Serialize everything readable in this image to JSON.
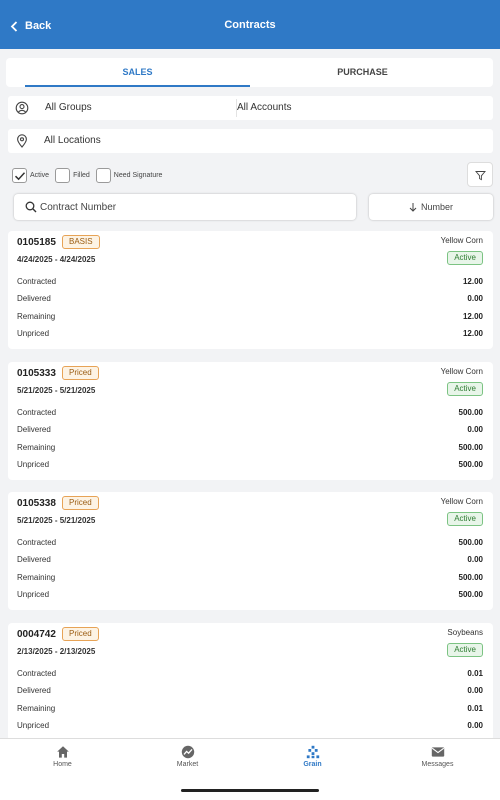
{
  "header": {
    "back_label": "Back",
    "title": "Contracts"
  },
  "tabs": [
    {
      "label": "SALES",
      "active": true
    },
    {
      "label": "PURCHASE",
      "active": false
    }
  ],
  "filters": {
    "groups": "All Groups",
    "accounts": "All Accounts",
    "locations": "All Locations",
    "checkboxes": [
      {
        "label": "Active",
        "checked": true
      },
      {
        "label": "Filled",
        "checked": false
      },
      {
        "label": "Need Signature",
        "checked": false
      }
    ]
  },
  "search": {
    "placeholder": "Contract Number"
  },
  "sort": {
    "label": "Number",
    "icon": "arrow-down-icon"
  },
  "row_labels": [
    "Contracted",
    "Delivered",
    "Remaining",
    "Unpriced"
  ],
  "contracts": [
    {
      "number": "0105185",
      "type": "BASIS",
      "dates": "4/24/2025 - 4/24/2025",
      "commodity": "Yellow Corn",
      "status": "Active",
      "contracted": "12.00",
      "delivered": "0.00",
      "remaining": "12.00",
      "unpriced": "12.00"
    },
    {
      "number": "0105333",
      "type": "Priced",
      "dates": "5/21/2025 - 5/21/2025",
      "commodity": "Yellow Corn",
      "status": "Active",
      "contracted": "500.00",
      "delivered": "0.00",
      "remaining": "500.00",
      "unpriced": "500.00"
    },
    {
      "number": "0105338",
      "type": "Priced",
      "dates": "5/21/2025 - 5/21/2025",
      "commodity": "Yellow Corn",
      "status": "Active",
      "contracted": "500.00",
      "delivered": "0.00",
      "remaining": "500.00",
      "unpriced": "500.00"
    },
    {
      "number": "0004742",
      "type": "Priced",
      "dates": "2/13/2025 - 2/13/2025",
      "commodity": "Soybeans",
      "status": "Active",
      "contracted": "0.01",
      "delivered": "0.00",
      "remaining": "0.01",
      "unpriced": "0.00"
    }
  ],
  "nav": [
    {
      "label": "Home",
      "icon": "home-icon",
      "active": false
    },
    {
      "label": "Market",
      "icon": "market-icon",
      "active": false
    },
    {
      "label": "Grain",
      "icon": "grain-icon",
      "active": true
    },
    {
      "label": "Messages",
      "icon": "envelope-icon",
      "active": false
    }
  ],
  "colors": {
    "primary": "#2f79c6",
    "badge_orange": "#e7a356",
    "status_green": "#7cc383",
    "background": "#f2f3f5"
  }
}
